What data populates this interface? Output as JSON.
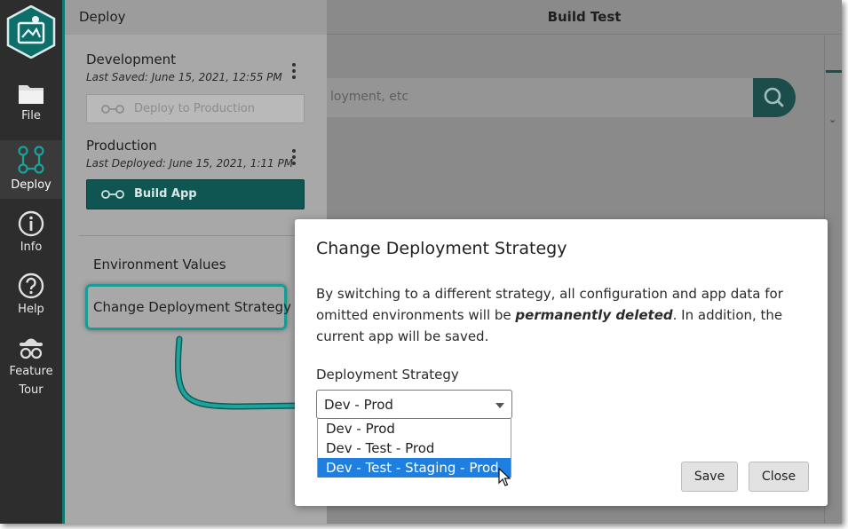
{
  "rail": {
    "items": [
      {
        "label": "File",
        "icon": "folder-icon"
      },
      {
        "label": "Deploy",
        "icon": "deploy-icon"
      },
      {
        "label": "Info",
        "icon": "info-icon"
      },
      {
        "label": "Help",
        "icon": "help-icon"
      },
      {
        "label": "Feature Tour",
        "label_line1": "Feature",
        "label_line2": "Tour",
        "icon": "feature-tour-icon"
      }
    ],
    "active": "Deploy",
    "accent_color": "#0b7a75"
  },
  "header": {
    "title": "Build Test"
  },
  "search": {
    "placeholder_fragment": "loyment, etc"
  },
  "panel": {
    "title": "Deploy",
    "environments": [
      {
        "name": "Development",
        "meta": "Last Saved: June 15, 2021, 12:55 PM",
        "button": "Deploy to Production",
        "button_enabled": false
      },
      {
        "name": "Production",
        "meta": "Last Deployed: June 15, 2021, 1:11 PM",
        "button": "Build App",
        "button_enabled": true
      }
    ],
    "links": {
      "environment_values": "Environment Values",
      "change_strategy": "Change Deployment Strategy"
    }
  },
  "modal": {
    "title": "Change Deployment Strategy",
    "body_prefix": "By switching to a different strategy, all configuration and app data for omitted environments will be ",
    "body_emphasis": "permanently deleted",
    "body_suffix": ". In addition, the current app will be saved.",
    "field_label": "Deployment Strategy",
    "selected_value": "Dev - Prod",
    "options": [
      "Dev - Prod",
      "Dev - Test - Prod",
      "Dev - Test - Staging - Prod"
    ],
    "highlighted_option": "Dev - Test - Staging - Prod",
    "save_label": "Save",
    "close_label": "Close"
  },
  "colors": {
    "teal": "#0f5551",
    "highlight_teal": "#1b9a96",
    "option_selected": "#1e7fe0"
  }
}
